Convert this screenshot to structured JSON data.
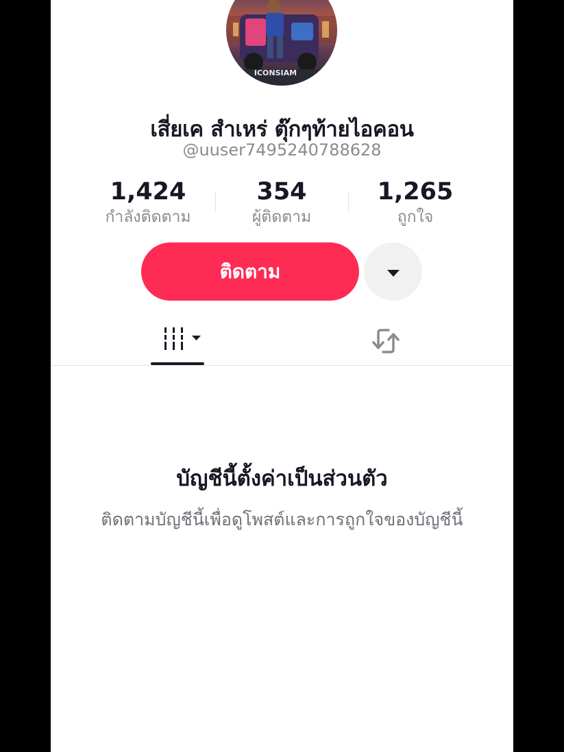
{
  "profile": {
    "display_name": "เสี่ยเค สำเหร่ ตุ๊กๆท้ายไอคอน",
    "username": "@uuser7495240788628",
    "avatar_text": "ICONSIAM"
  },
  "stats": {
    "following": {
      "value": "1,424",
      "label": "กำลังติดตาม"
    },
    "followers": {
      "value": "354",
      "label": "ผู้ติดตาม"
    },
    "likes": {
      "value": "1,265",
      "label": "ถูกใจ"
    }
  },
  "actions": {
    "follow_label": "ติดตาม",
    "more_icon": "caret-down-icon"
  },
  "tabs": [
    {
      "name": "videos",
      "icon": "video-grid-icon",
      "active": true
    },
    {
      "name": "reposts",
      "icon": "repost-icon",
      "active": false
    }
  ],
  "private_notice": {
    "title": "บัญชีนี้ตั้งค่าเป็นส่วนตัว",
    "description": "ติดตามบัญชีนี้เพื่อดูโพสต์และการถูกใจของบัญชีนี้"
  },
  "colors": {
    "accent": "#fe2c55",
    "text_primary": "#161823",
    "text_secondary": "#8a8b91",
    "button_secondary": "#f1f1f2"
  }
}
